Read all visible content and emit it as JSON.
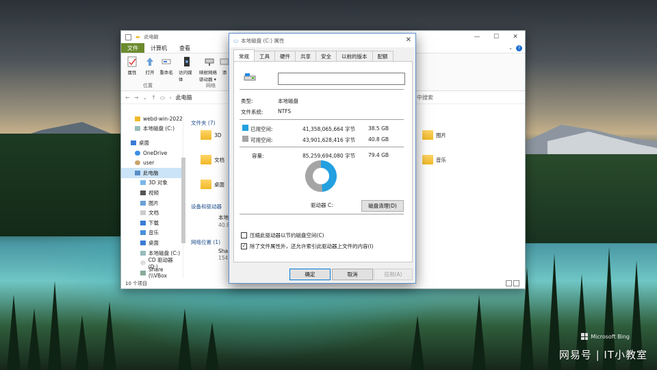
{
  "explorer": {
    "title": "此电脑",
    "ribbon_tabs": [
      "文件",
      "计算机",
      "查看"
    ],
    "ribbon_buttons": [
      "属性",
      "打开",
      "重命名",
      "访问媒体",
      "映射网络驱动器 ▾",
      "添"
    ],
    "ribbon_groups": [
      "位置",
      "网络"
    ],
    "address_crumb": "此电脑",
    "search_placeholder": "中搜索",
    "nav_items": [
      {
        "label": "webd-win-2022",
        "icon": "folder-icon"
      },
      {
        "label": "本地磁盘 (C:)",
        "icon": "drive-icon"
      },
      {
        "label": "桌面",
        "icon": "desktop-icon"
      },
      {
        "label": "OneDrive",
        "icon": "cloud-icon"
      },
      {
        "label": "user",
        "icon": "user-icon"
      },
      {
        "label": "此电脑",
        "icon": "computer-icon"
      },
      {
        "label": "3D 对象",
        "icon": "cube-icon"
      },
      {
        "label": "视频",
        "icon": "video-icon"
      },
      {
        "label": "图片",
        "icon": "picture-icon"
      },
      {
        "label": "文档",
        "icon": "document-icon"
      },
      {
        "label": "下载",
        "icon": "download-icon"
      },
      {
        "label": "音乐",
        "icon": "music-icon"
      },
      {
        "label": "桌面",
        "icon": "desktop-icon"
      },
      {
        "label": "本地磁盘 (C:)",
        "icon": "drive-icon"
      },
      {
        "label": "CD 驱动器 (D:)",
        "icon": "cd-icon"
      },
      {
        "label": "Share (\\\\VBox",
        "icon": "network-drive-icon"
      }
    ],
    "sections": {
      "folders": "文件夹 (7)",
      "devices": "设备和驱动器",
      "network": "网络位置 (1)"
    },
    "folder_items": [
      "3D",
      "文档",
      "桌面",
      "图片",
      "音乐"
    ],
    "drive_items": {
      "local_name": "本地",
      "local_size": "40.8",
      "share_name": "Sha",
      "share_size": "154"
    },
    "status": "10 个项目"
  },
  "dialog": {
    "title": "本地磁盘 (C:) 属性",
    "tabs": [
      "常规",
      "工具",
      "硬件",
      "共享",
      "安全",
      "以前的版本",
      "配额"
    ],
    "active_tab": "常规",
    "name_value": "",
    "type_label": "类型:",
    "type_value": "本地磁盘",
    "fs_label": "文件系统:",
    "fs_value": "NTFS",
    "used_label": "已用空间:",
    "used_bytes": "41,358,065,664 字节",
    "used_size": "38.5 GB",
    "free_label": "可用空间:",
    "free_bytes": "43,901,628,416 字节",
    "free_size": "40.8 GB",
    "capacity_label": "容量:",
    "capacity_bytes": "85,259,694,080 字节",
    "capacity_size": "79.4 GB",
    "used_fraction": 0.485,
    "drive_label": "驱动器 C:",
    "cleanup_button": "磁盘清理(D)",
    "compress_label": "压缩此驱动器以节约磁盘空间(C)",
    "compress_checked": false,
    "index_label": "除了文件属性外，还允许索引此驱动器上文件的内容(I)",
    "index_checked": true,
    "ok": "确定",
    "cancel": "取消",
    "apply": "应用(A)",
    "colors": {
      "used": "#22a0e0",
      "free": "#a5a5a5",
      "accent": "#0078d7"
    }
  },
  "watermark": {
    "brand": "Microsoft Bing",
    "site": "网易号 | IT小教室"
  }
}
